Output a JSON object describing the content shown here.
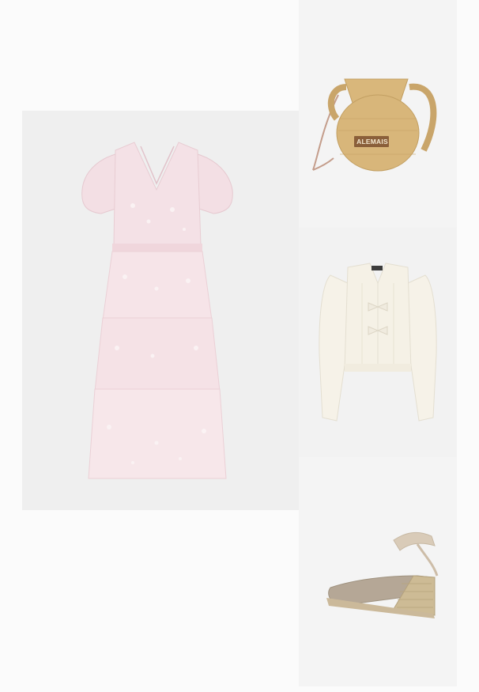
{
  "items": [
    {
      "name": "dress"
    },
    {
      "name": "straw-bag",
      "brand_label": "ALEMAIS"
    },
    {
      "name": "cardigan"
    },
    {
      "name": "espadrille-wedge"
    }
  ],
  "colors": {
    "background": "#fbfbfb",
    "tile": "#f2f2f2",
    "dress": "#f4dde2",
    "bag": "#d8b67a",
    "cardigan": "#f5f1e6",
    "shoe": "#b5a796"
  }
}
